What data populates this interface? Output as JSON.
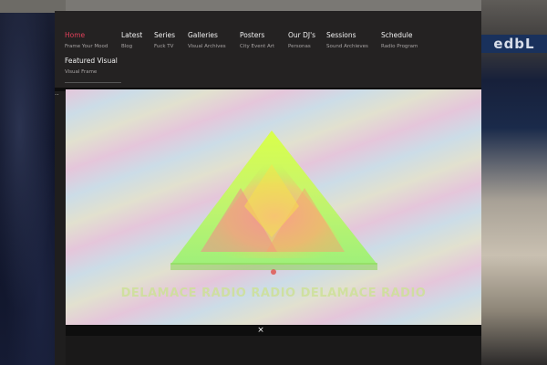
{
  "nav": {
    "items": [
      {
        "label": "Home",
        "sub": "Frame Your Mood",
        "active": true
      },
      {
        "label": "Latest",
        "sub": "Blog",
        "active": false
      },
      {
        "label": "Series",
        "sub": "Fuck TV",
        "active": false
      },
      {
        "label": "Galleries",
        "sub": "Visual Archives",
        "active": false
      },
      {
        "label": "Posters",
        "sub": "City Event Art",
        "active": false
      },
      {
        "label": "Our DJ's",
        "sub": "Personas",
        "active": false
      },
      {
        "label": "Sessions",
        "sub": "Sound Archieves",
        "active": false
      },
      {
        "label": "Schedule",
        "sub": "Radio Program",
        "active": false
      },
      {
        "label": "Featured Visual",
        "sub": "Visual Frame",
        "active": false
      }
    ],
    "active_color": "#e0405a"
  },
  "background": {
    "sign_text": "edbL"
  },
  "visual": {
    "caption": "DELAMACE RADIO RADIO DELAMACE RADIO",
    "close_symbol": "×"
  },
  "page": {
    "left_dots": ".."
  }
}
